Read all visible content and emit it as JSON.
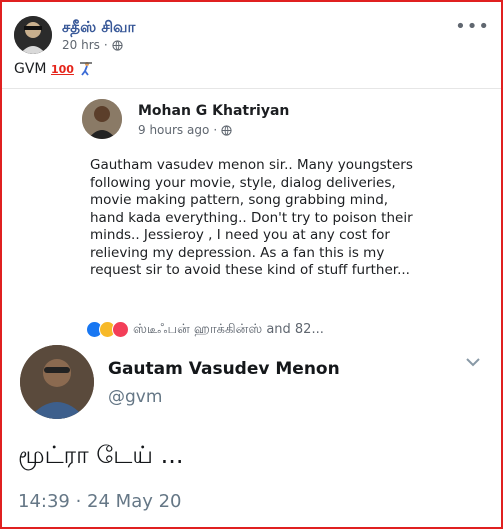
{
  "post": {
    "author": "சதீஸ் சிவா",
    "time": "20 hrs",
    "text": "GVM",
    "emoji_100": "100",
    "globe_icon": "globe-icon",
    "more_icon": "more-options-icon"
  },
  "embedded_fb": {
    "author": "Mohan G Khatriyan",
    "time": "9 hours ago",
    "body": "Gautham vasudev menon sir.. Many youngsters following your movie, style, dialog deliveries, movie making pattern, song grabbing mind, hand kada everything.. Don't try to poison their minds.. Jessieroy , I need you at any cost for relieving my depression. As a fan this is my request sir to avoid these kind of stuff further...",
    "reactions_text": "ஸ்டீஃபன் ஹாக்கின்ஸ் and 82..."
  },
  "tweet": {
    "name": "Gautam Vasudev Menon",
    "handle": "@gvm",
    "text": "மூட்ரா டேய் ...",
    "timestamp": "14:39 · 24 May 20"
  },
  "colors": {
    "frame_border": "#e02020",
    "fb_link": "#385898",
    "twitter_gray": "#657786"
  }
}
